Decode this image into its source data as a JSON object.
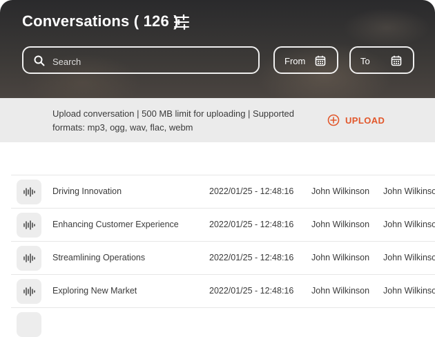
{
  "header": {
    "title": "Conversations",
    "count": "( 126 )",
    "search_placeholder": "Search",
    "from_label": "From",
    "to_label": "To"
  },
  "upload": {
    "info": "Upload conversation  |  500 MB limit for uploading  |  Supported formats: mp3, ogg, wav, flac, webm",
    "button_label": "UPLOAD"
  },
  "colors": {
    "accent": "#e2572b",
    "upload_bar_bg": "#ebebeb"
  },
  "rows": [
    {
      "title": "Driving Innovation",
      "date": "2022/01/25 - 12:48:16",
      "person1": "John Wilkinson",
      "person2": "John Wilkinson"
    },
    {
      "title": "Enhancing Customer Experience",
      "date": "2022/01/25 - 12:48:16",
      "person1": "John Wilkinson",
      "person2": "John Wilkinson"
    },
    {
      "title": "Streamlining Operations",
      "date": "2022/01/25 - 12:48:16",
      "person1": "John Wilkinson",
      "person2": "John Wilkinson"
    },
    {
      "title": "Exploring New Market",
      "date": "2022/01/25 - 12:48:16",
      "person1": "John Wilkinson",
      "person2": "John Wilkinson"
    }
  ]
}
